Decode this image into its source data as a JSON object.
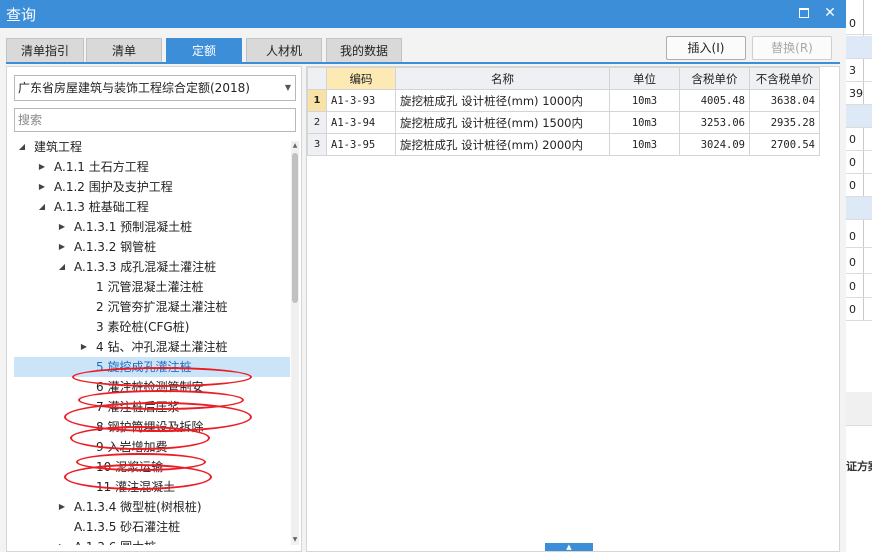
{
  "window": {
    "title": "查询"
  },
  "tabs": [
    {
      "label": "清单指引",
      "active": false
    },
    {
      "label": "清单",
      "active": false
    },
    {
      "label": "定额",
      "active": true
    },
    {
      "label": "人材机",
      "active": false
    },
    {
      "label": "我的数据",
      "active": false
    }
  ],
  "actions": {
    "insert_label": "插入(I)",
    "replace_label": "替换(R)"
  },
  "library": {
    "selected": "广东省房屋建筑与装饰工程综合定额(2018)"
  },
  "search": {
    "placeholder": "搜索"
  },
  "tree": [
    {
      "label": "建筑工程",
      "expander": "expanded"
    },
    {
      "label": "A.1.1 土石方工程",
      "expander": "collapsed"
    },
    {
      "label": "A.1.2 围护及支护工程",
      "expander": "collapsed"
    },
    {
      "label": "A.1.3 桩基础工程",
      "expander": "expanded"
    },
    {
      "label": "A.1.3.1 预制混凝土桩",
      "expander": "collapsed"
    },
    {
      "label": "A.1.3.2 钢管桩",
      "expander": "collapsed"
    },
    {
      "label": "A.1.3.3 成孔混凝土灌注桩",
      "expander": "expanded"
    },
    {
      "label": "1 沉管混凝土灌注桩",
      "expander": "none"
    },
    {
      "label": "2 沉管夯扩混凝土灌注桩",
      "expander": "none"
    },
    {
      "label": "3 素砼桩(CFG桩)",
      "expander": "none"
    },
    {
      "label": "4 钻、冲孔混凝土灌注桩",
      "expander": "collapsed"
    },
    {
      "label": "5 旋挖成孔灌注桩",
      "expander": "none",
      "selected": true
    },
    {
      "label": "6 灌注桩检测管制安",
      "expander": "none"
    },
    {
      "label": "7 灌注桩后压浆",
      "expander": "none"
    },
    {
      "label": "8 钢护筒埋设及拆除",
      "expander": "none"
    },
    {
      "label": "9 入岩增加费",
      "expander": "none"
    },
    {
      "label": "10 泥浆运输",
      "expander": "none"
    },
    {
      "label": "11 灌注混凝土",
      "expander": "none"
    },
    {
      "label": "A.1.3.4 微型桩(树根桩)",
      "expander": "collapsed"
    },
    {
      "label": "A.1.3.5 砂石灌注桩",
      "expander": "none"
    },
    {
      "label": "A.1.3.6 圆木桩",
      "expander": "collapsed"
    }
  ],
  "table": {
    "headers": [
      "",
      "编码",
      "名称",
      "单位",
      "含税单价",
      "不含税单价"
    ],
    "rows": [
      {
        "no": "1",
        "code": "A1-3-93",
        "name": "旋挖桩成孔 设计桩径(mm) 1000内",
        "unit": "10m3",
        "price_tax": "4005.48",
        "price_notax": "3638.04"
      },
      {
        "no": "2",
        "code": "A1-3-94",
        "name": "旋挖桩成孔 设计桩径(mm) 1500内",
        "unit": "10m3",
        "price_tax": "3253.06",
        "price_notax": "2935.28"
      },
      {
        "no": "3",
        "code": "A1-3-95",
        "name": "旋挖桩成孔 设计桩径(mm) 2000内",
        "unit": "10m3",
        "price_tax": "3024.09",
        "price_notax": "2700.54"
      }
    ]
  },
  "background_strip": {
    "cells": [
      "0",
      "",
      "",
      "3",
      "39",
      "",
      "0",
      "0",
      "0",
      "",
      "0",
      "",
      "0",
      "0",
      "0"
    ],
    "bottom_text": "证方案"
  },
  "colors": {
    "accent": "#3c8ed8",
    "annotation": "#ec1c24",
    "selected_row": "#cce4f7"
  }
}
